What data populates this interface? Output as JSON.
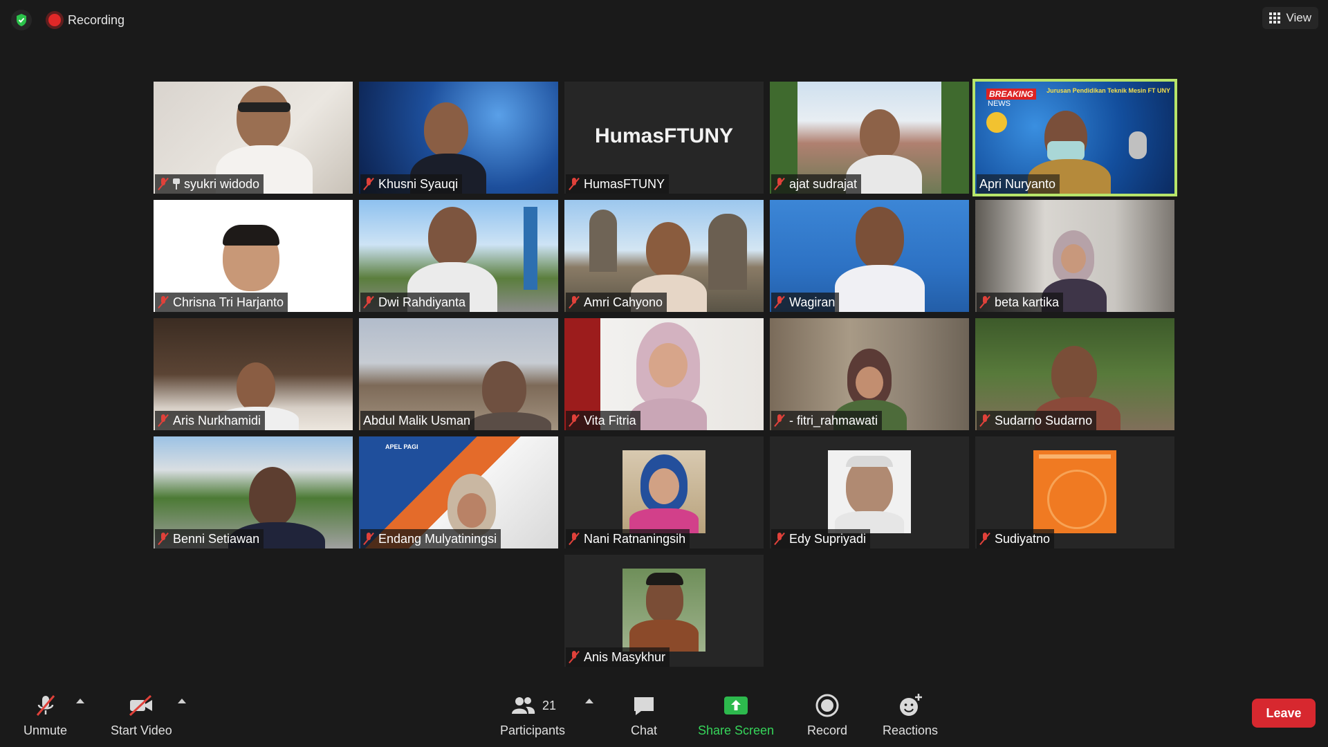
{
  "topbar": {
    "recording_label": "Recording",
    "view_label": "View"
  },
  "active_speaker": "Apri Nuryanto",
  "tiles": [
    {
      "name": "syukri widodo",
      "muted": true,
      "pinned": true
    },
    {
      "name": "Khusni Syauqi",
      "muted": true
    },
    {
      "name": "HumasFTUNY",
      "muted": true,
      "display_text": "HumasFTUNY"
    },
    {
      "name": "ajat sudrajat",
      "muted": true
    },
    {
      "name": "Apri Nuryanto",
      "muted": false,
      "active": true,
      "overlay_texts": [
        "BREAKING",
        "NEWS",
        "Jurusan Pendidikan Teknik Mesin FT UNY"
      ]
    },
    {
      "name": "Chrisna Tri Harjanto",
      "muted": true
    },
    {
      "name": "Dwi Rahdiyanta",
      "muted": true
    },
    {
      "name": "Amri Cahyono",
      "muted": true
    },
    {
      "name": "Wagiran",
      "muted": true
    },
    {
      "name": "beta kartika",
      "muted": true
    },
    {
      "name": "Aris Nurkhamidi",
      "muted": true
    },
    {
      "name": "Abdul Malik Usman",
      "muted": false
    },
    {
      "name": "Vita Fitria",
      "muted": true
    },
    {
      "name": "- fitri_rahmawati",
      "muted": true
    },
    {
      "name": "Sudarno Sudarno",
      "muted": true
    },
    {
      "name": "Benni Setiawan",
      "muted": true
    },
    {
      "name": "Endang Mulyatiningsi",
      "muted": true,
      "overlay_texts": [
        "APEL PAGI"
      ]
    },
    {
      "name": "Nani Ratnaningsih",
      "muted": true
    },
    {
      "name": "Edy Supriyadi",
      "muted": true
    },
    {
      "name": "Sudiyatno",
      "muted": true
    },
    {
      "name": "Anis Masykhur",
      "muted": true
    }
  ],
  "toolbar": {
    "unmute_label": "Unmute",
    "start_video_label": "Start Video",
    "participants_label": "Participants",
    "participants_count": "21",
    "chat_label": "Chat",
    "share_screen_label": "Share Screen",
    "record_label": "Record",
    "reactions_label": "Reactions",
    "leave_label": "Leave"
  },
  "colors": {
    "background": "#1a1a1a",
    "tile_background": "#262626",
    "active_border": "#b7e46a",
    "muted_icon": "#e0413a",
    "share_green": "#36d55a",
    "leave_red": "#d7282f"
  }
}
